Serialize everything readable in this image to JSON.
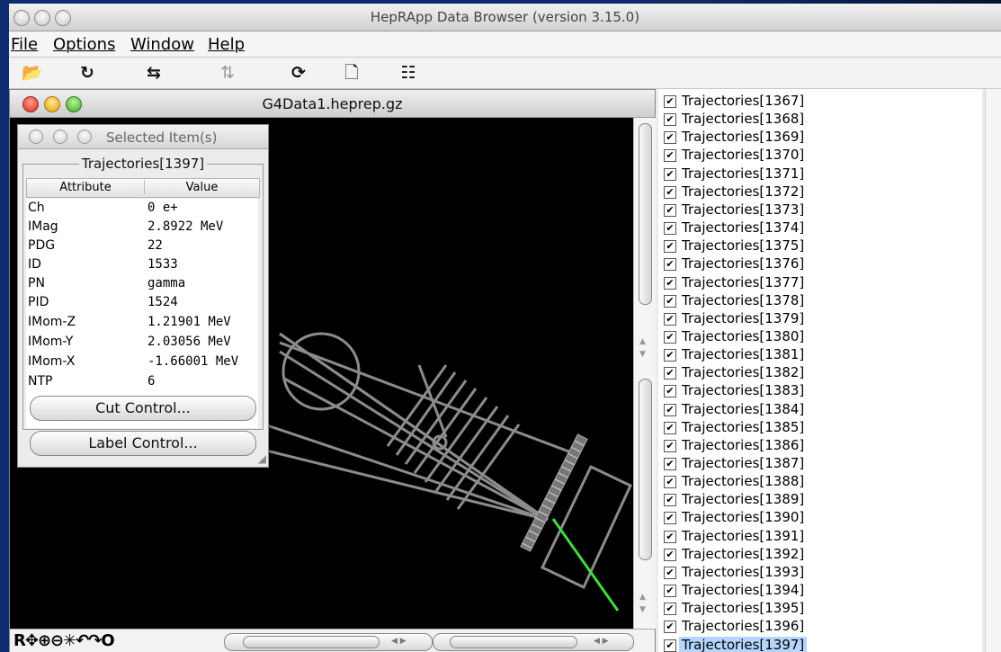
{
  "window": {
    "title": "HepRApp Data Browser (version 3.15.0)"
  },
  "menu": [
    {
      "label": "File"
    },
    {
      "label": "Options"
    },
    {
      "label": "Window"
    },
    {
      "label": "Help"
    }
  ],
  "toolbar": [
    {
      "icon": "open-folder-icon",
      "glyph": "📂"
    },
    {
      "icon": "rotate-icon",
      "glyph": "↻"
    },
    {
      "icon": "horizontal-arrows-icon",
      "glyph": "⇆"
    },
    {
      "icon": "vertical-arrows-icon",
      "glyph": "⇅"
    },
    {
      "icon": "spin-icon",
      "glyph": "⟳"
    },
    {
      "icon": "new-document-icon",
      "glyph": "🗋"
    },
    {
      "icon": "tree-icon",
      "glyph": "☷"
    }
  ],
  "viewer": {
    "title": "G4Data1.heprep.gz",
    "tools": "R✥⊕⊖✳↶↷O"
  },
  "selected_panel": {
    "title": "Selected Item(s)",
    "group": "Trajectories[1397]",
    "columns": [
      "Attribute",
      "Value"
    ],
    "rows": [
      {
        "attribute": "Ch",
        "value": "0 e+"
      },
      {
        "attribute": "IMag",
        "value": "2.8922 MeV"
      },
      {
        "attribute": "PDG",
        "value": "22"
      },
      {
        "attribute": "ID",
        "value": "1533"
      },
      {
        "attribute": "PN",
        "value": "gamma"
      },
      {
        "attribute": "PID",
        "value": "1524"
      },
      {
        "attribute": "IMom-Z",
        "value": "1.21901 MeV"
      },
      {
        "attribute": "IMom-Y",
        "value": "2.03056 MeV"
      },
      {
        "attribute": "IMom-X",
        "value": "-1.66001 MeV"
      },
      {
        "attribute": "NTP",
        "value": "6"
      }
    ],
    "cut_button": "Cut Control...",
    "label_button": "Label Control..."
  },
  "trajectory_list": [
    "Trajectories[1367]",
    "Trajectories[1368]",
    "Trajectories[1369]",
    "Trajectories[1370]",
    "Trajectories[1371]",
    "Trajectories[1372]",
    "Trajectories[1373]",
    "Trajectories[1374]",
    "Trajectories[1375]",
    "Trajectories[1376]",
    "Trajectories[1377]",
    "Trajectories[1378]",
    "Trajectories[1379]",
    "Trajectories[1380]",
    "Trajectories[1381]",
    "Trajectories[1382]",
    "Trajectories[1383]",
    "Trajectories[1384]",
    "Trajectories[1385]",
    "Trajectories[1386]",
    "Trajectories[1387]",
    "Trajectories[1388]",
    "Trajectories[1389]",
    "Trajectories[1390]",
    "Trajectories[1391]",
    "Trajectories[1392]",
    "Trajectories[1393]",
    "Trajectories[1394]",
    "Trajectories[1395]",
    "Trajectories[1396]",
    "Trajectories[1397]"
  ],
  "selected_trajectory": "Trajectories[1397]",
  "colors": {
    "selection": "#b5d5ff",
    "track_gray": "#8c8c8c",
    "track_green": "#3fdc3f",
    "canvas": "#000000"
  }
}
